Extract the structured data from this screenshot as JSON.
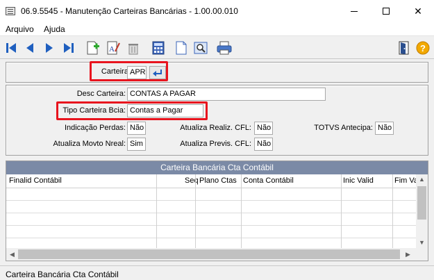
{
  "window": {
    "title": "06.9.5545 - Manutenção Carteiras Bancárias - 1.00.00.010"
  },
  "menu": {
    "items": [
      "Arquivo",
      "Ajuda"
    ]
  },
  "toolbar": {
    "buttons": [
      "first-record",
      "previous-record",
      "next-record",
      "last-record",
      "new-record",
      "edit-record",
      "delete-record",
      "calculator",
      "document",
      "print-preview",
      "print",
      "exit",
      "help"
    ]
  },
  "header_form": {
    "carteira_label": "Carteira:",
    "carteira_value": "APR"
  },
  "detail_form": {
    "desc_label": "Desc Carteira:",
    "desc_value": "CONTAS A PAGAR",
    "tipo_label": "Tipo Carteira Bcia:",
    "tipo_value": "Contas a Pagar",
    "indicacao_label": "Indicação Perdas:",
    "indicacao_value": "Não",
    "atualiza_movto_label": "Atualiza Movto Nreal:",
    "atualiza_movto_value": "Sim",
    "atualiza_realiz_label": "Atualiza Realiz. CFL:",
    "atualiza_realiz_value": "Não",
    "atualiza_previs_label": "Atualiza Previs. CFL:",
    "atualiza_previs_value": "Não",
    "totvs_label": "TOTVS Antecipa:",
    "totvs_value": "Não"
  },
  "grid": {
    "title": "Carteira Bancária Cta Contábil",
    "columns": [
      "Finalid Contábil",
      "Seq",
      "Plano Ctas",
      "Conta Contábil",
      "Inic Valid",
      "Fim Va"
    ],
    "rows": []
  },
  "statusbar": {
    "text": "Carteira Bancária Cta Contábil"
  },
  "colors": {
    "highlight": "#e8141e",
    "grid_header": "#7b8aa6",
    "toolbar_blue": "#1f5fbf"
  }
}
